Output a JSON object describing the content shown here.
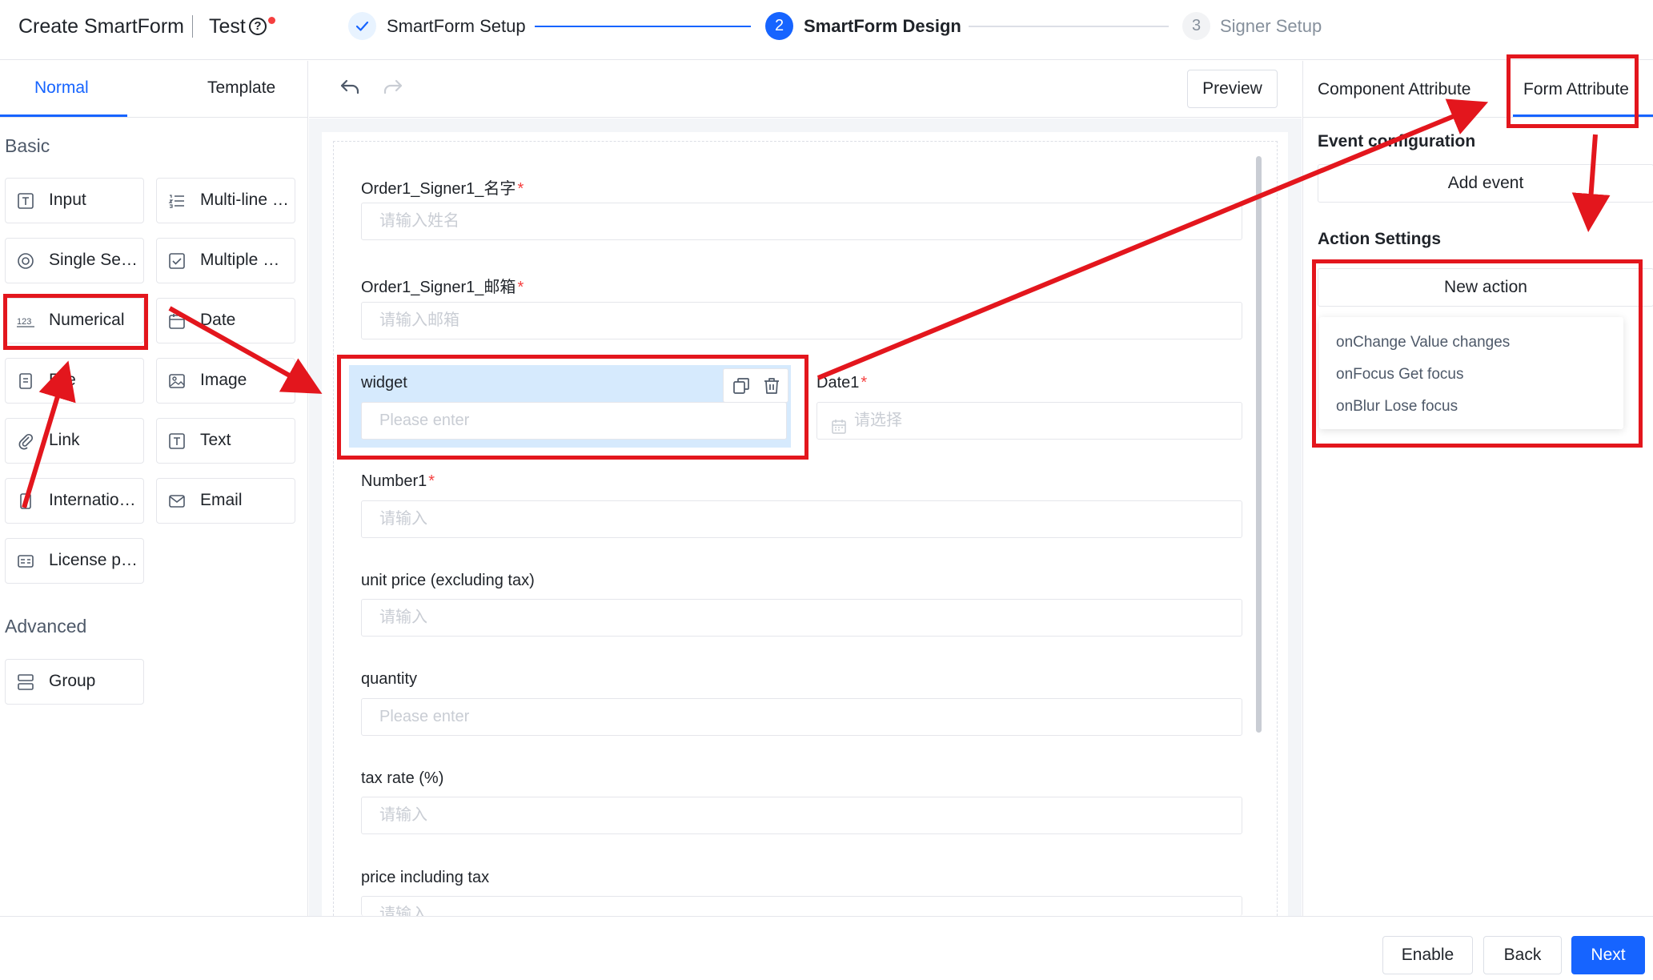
{
  "header": {
    "app_title": "Create SmartForm",
    "doc_name": "Test",
    "help_glyph": "?",
    "steps": [
      {
        "number": "1",
        "label": "SmartForm Setup",
        "state": "done"
      },
      {
        "number": "2",
        "label": "SmartForm Design",
        "state": "active"
      },
      {
        "number": "3",
        "label": "Signer Setup",
        "state": "todo"
      }
    ]
  },
  "left_panel": {
    "tabs": [
      "Normal",
      "Template"
    ],
    "active_tab": "Normal",
    "basic_title": "Basic",
    "advanced_title": "Advanced",
    "basic_components": [
      {
        "label": "Input",
        "icon": "text-field-icon"
      },
      {
        "label": "Multi-line text",
        "icon": "list-icon"
      },
      {
        "label": "Single Select",
        "icon": "radio-icon"
      },
      {
        "label": "Multiple Select",
        "icon": "checkbox-icon"
      },
      {
        "label": "Numerical",
        "icon": "number-icon"
      },
      {
        "label": "Date",
        "icon": "calendar-icon"
      },
      {
        "label": "File",
        "icon": "file-icon"
      },
      {
        "label": "Image",
        "icon": "image-icon"
      },
      {
        "label": "Link",
        "icon": "paperclip-icon"
      },
      {
        "label": "Text",
        "icon": "text-icon"
      },
      {
        "label": "International Phone",
        "icon": "phone-icon"
      },
      {
        "label": "Email",
        "icon": "mail-icon"
      },
      {
        "label": "License plate",
        "icon": "id-card-icon"
      }
    ],
    "advanced_components": [
      {
        "label": "Group",
        "icon": "group-icon"
      }
    ]
  },
  "toolbar": {
    "preview_label": "Preview"
  },
  "canvas": {
    "fields": [
      {
        "label": "Order1_Signer1_名字",
        "required": true,
        "placeholder": "请输入姓名"
      },
      {
        "label": "Order1_Signer1_邮箱",
        "required": true,
        "placeholder": "请输入邮箱"
      },
      {
        "label": "widget",
        "required": false,
        "placeholder": "Please enter",
        "selected": true
      },
      {
        "label": "Date1",
        "required": true,
        "placeholder": "请选择"
      },
      {
        "label": "Number1",
        "required": true,
        "placeholder": "请输入"
      },
      {
        "label": "unit price (excluding tax)",
        "required": false,
        "placeholder": "请输入"
      },
      {
        "label": "quantity",
        "required": false,
        "placeholder": "Please enter"
      },
      {
        "label": "tax rate (%)",
        "required": false,
        "placeholder": "请输入"
      },
      {
        "label": "price including tax",
        "required": false,
        "placeholder": "请输入"
      }
    ],
    "required_mark": "*"
  },
  "right_panel": {
    "tabs": [
      "Component Attribute",
      "Form Attribute"
    ],
    "active_tab": "Form Attribute",
    "event_heading": "Event configuration",
    "add_event_label": "Add event",
    "action_heading": "Action Settings",
    "new_action_label": "New action",
    "action_menu": [
      "onChange Value changes",
      "onFocus Get focus",
      "onBlur Lose focus"
    ]
  },
  "footer": {
    "enable_label": "Enable",
    "back_label": "Back",
    "next_label": "Next"
  },
  "colors": {
    "accent": "#1664ff",
    "annotation_red": "#e3161d",
    "selected_widget_bg": "#d6eafd",
    "required_red": "#f53f3f"
  }
}
